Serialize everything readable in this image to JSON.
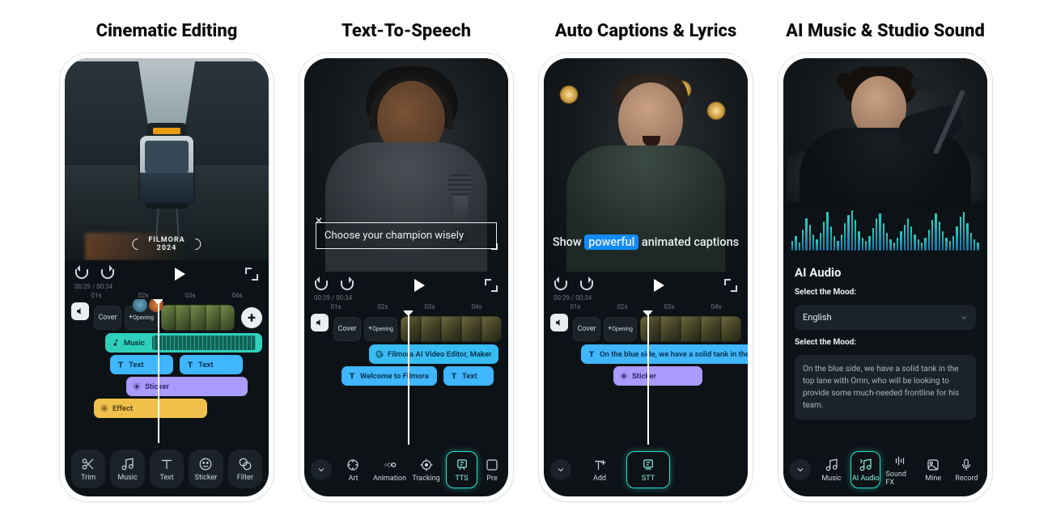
{
  "panels": {
    "p1": {
      "title": "Cinematic Editing",
      "badge_top": "FILMORA",
      "badge_year": "2024",
      "time_cur": "00:29",
      "time_total": "00:34",
      "ruler": [
        "01s",
        "02s",
        "03s",
        "04s"
      ],
      "cells": {
        "cover": "Cover",
        "opening": "Opening"
      },
      "clips": {
        "music": "Music",
        "text": "Text",
        "sticker": "Sticker",
        "effect": "Effect"
      },
      "tools": {
        "trim": "Trim",
        "music": "Music",
        "text": "Text",
        "sticker": "Sticker",
        "filter": "Filter"
      }
    },
    "p2": {
      "title": "Text-To-Speech",
      "caption": "Choose your champion wisely",
      "time_cur": "00:29",
      "time_total": "00:34",
      "ruler": [
        "01s",
        "02s",
        "03s",
        "04s"
      ],
      "cells": {
        "cover": "Cover",
        "opening": "Opening"
      },
      "clips": {
        "ai": "Filmora AI Video Editor, Maker",
        "welcome": "Welcome to Filmora",
        "text": "Text"
      },
      "tools": {
        "ai_art": "Art",
        "animation": "Animation",
        "tracking": "Tracking",
        "tts": "TTS",
        "pre": "Pre"
      }
    },
    "p3": {
      "title": "Auto Captions & Lyrics",
      "cap_pre": "Show ",
      "cap_hl": "powerful",
      "cap_post": " animated captions",
      "time_cur": "00:29",
      "time_total": "00:34",
      "ruler": [
        "01s",
        "02s",
        "03s",
        "04s"
      ],
      "cells": {
        "cover": "Cover",
        "opening": "Opening"
      },
      "clips": {
        "line": "On the blue side,  we have a solid tank in the top",
        "sticker": "Sticker"
      },
      "tools": {
        "add": "Add",
        "stt": "STT"
      }
    },
    "p4": {
      "title": "AI Music & Studio Sound",
      "section": "AI Audio",
      "label1": "Select the Mood:",
      "select_value": "English",
      "label2": "Select the Mood:",
      "desc": "On the blue side, we have a solid tank in the top lane with Ornn, who will be looking to provide some much-needed frontline for his team.",
      "tools": {
        "music": "Music",
        "ai_audio": "AI Audio",
        "soundfx": "Sound FX",
        "mine": "Mine",
        "record": "Record"
      }
    }
  }
}
